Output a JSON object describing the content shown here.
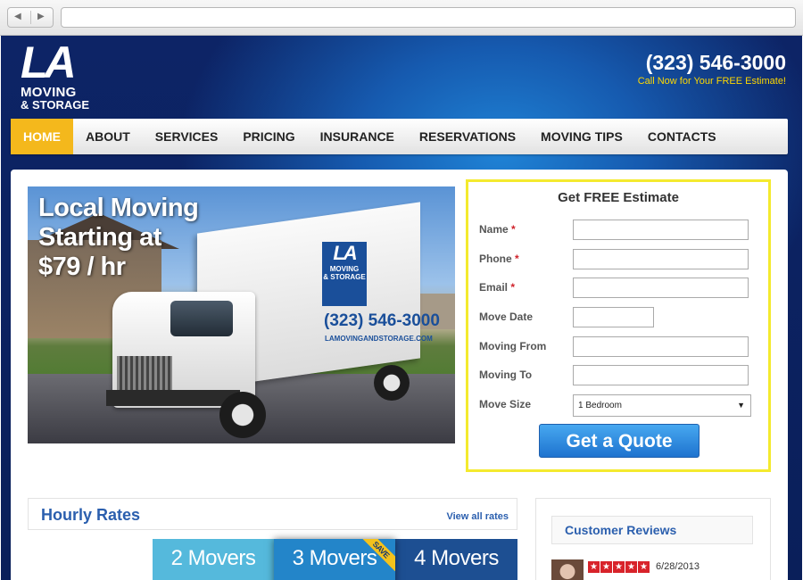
{
  "browser": {
    "back_icon": "back-arrow-icon",
    "forward_icon": "forward-arrow-icon",
    "back_glyph": "◀",
    "forward_glyph": "▶"
  },
  "header": {
    "logo": {
      "la": "LA",
      "moving": "MOVING",
      "storage": "& STORAGE"
    },
    "phone": "(323) 546-3000",
    "call_now": "Call Now for Your FREE Estimate!"
  },
  "nav": {
    "items": [
      "HOME",
      "ABOUT",
      "SERVICES",
      "PRICING",
      "INSURANCE",
      "RESERVATIONS",
      "MOVING TIPS",
      "CONTACTS"
    ],
    "active": "HOME"
  },
  "hero": {
    "headline_1": "Local Moving",
    "headline_2": "Starting at",
    "headline_3": "$79 / hr",
    "truck_logo_1": "LA",
    "truck_logo_2": "MOVING",
    "truck_logo_3": "& STORAGE",
    "truck_phone": "(323) 546-3000",
    "truck_site": "LAMOVINGANDSTORAGE.COM"
  },
  "estimate": {
    "title": "Get FREE Estimate",
    "required_mark": "*",
    "fields": [
      {
        "label": "Name",
        "required": true,
        "value": ""
      },
      {
        "label": "Phone",
        "required": true,
        "value": ""
      },
      {
        "label": "Email",
        "required": true,
        "value": ""
      },
      {
        "label": "Move Date",
        "required": false,
        "value": ""
      },
      {
        "label": "Moving From",
        "required": false,
        "value": ""
      },
      {
        "label": "Moving To",
        "required": false,
        "value": ""
      },
      {
        "label": "Move Size",
        "required": false,
        "value": "1 Bedroom"
      }
    ],
    "select_arrow": "▼",
    "button": "Get a Quote"
  },
  "rates": {
    "title": "Hourly Rates",
    "link": "View all rates",
    "tabs": [
      "2 Movers",
      "3 Movers",
      "4 Movers"
    ],
    "badge": "SAVE"
  },
  "reviews": {
    "title": "Customer Reviews",
    "rating": 5,
    "star_glyph": "★",
    "date": "6/28/2013"
  },
  "colors": {
    "nav_active": "#f4b81c",
    "link_blue": "#2b5fae",
    "estimate_border": "#f4ea2e",
    "call_now": "#ffd800",
    "star_red": "#d8232a"
  }
}
